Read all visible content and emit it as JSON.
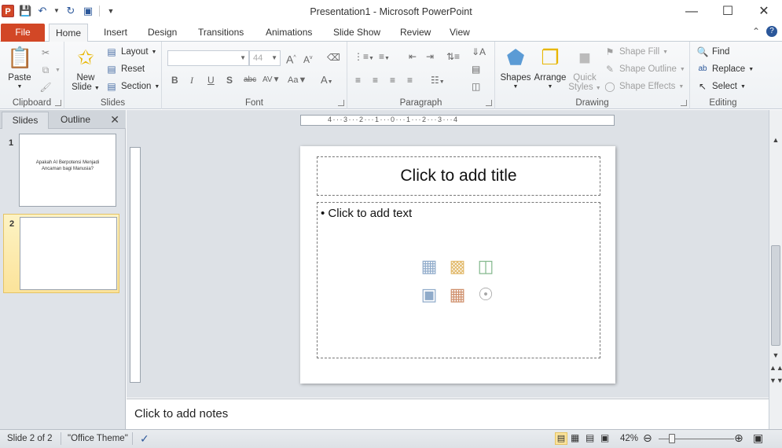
{
  "app": {
    "title": "Presentation1  -  Microsoft PowerPoint",
    "logo_letter": "P"
  },
  "qat": {
    "save_icon": "save-icon",
    "undo_icon": "undo-icon",
    "redo_icon": "redo-icon",
    "start_icon": "start-from-beginning-icon"
  },
  "tabs": [
    {
      "label": "File"
    },
    {
      "label": "Home"
    },
    {
      "label": "Insert"
    },
    {
      "label": "Design"
    },
    {
      "label": "Transitions"
    },
    {
      "label": "Animations"
    },
    {
      "label": "Slide Show"
    },
    {
      "label": "Review"
    },
    {
      "label": "View"
    }
  ],
  "ribbon": {
    "clipboard": {
      "label": "Clipboard",
      "paste": "Paste"
    },
    "slides": {
      "label": "Slides",
      "new_slide_line1": "New",
      "new_slide_line2": "Slide",
      "layout": "Layout",
      "reset": "Reset",
      "section": "Section"
    },
    "font": {
      "label": "Font",
      "font_name": "",
      "font_size": "44"
    },
    "paragraph": {
      "label": "Paragraph"
    },
    "drawing": {
      "label": "Drawing",
      "shapes": "Shapes",
      "arrange": "Arrange",
      "quick_styles_line1": "Quick",
      "quick_styles_line2": "Styles",
      "shape_fill": "Shape Fill",
      "shape_outline": "Shape Outline",
      "shape_effects": "Shape Effects"
    },
    "editing": {
      "label": "Editing",
      "find": "Find",
      "replace": "Replace",
      "select": "Select"
    }
  },
  "leftpane": {
    "tab_slides": "Slides",
    "tab_outline": "Outline",
    "slides": [
      {
        "number": "1",
        "text": "Apakah AI Berpotensi Menjadi Ancaman bagi Manusia?"
      },
      {
        "number": "2",
        "text": ""
      }
    ]
  },
  "hruler_text": "4···3···2···1···0···1···2···3···4",
  "slide": {
    "title_placeholder": "Click to add title",
    "body_placeholder": "Click to add text"
  },
  "notes_placeholder": "Click to add notes",
  "status": {
    "slide_info": "Slide 2 of 2",
    "theme": "\"Office Theme\"",
    "zoom": "42%",
    "zoom_level_percent": 42
  }
}
